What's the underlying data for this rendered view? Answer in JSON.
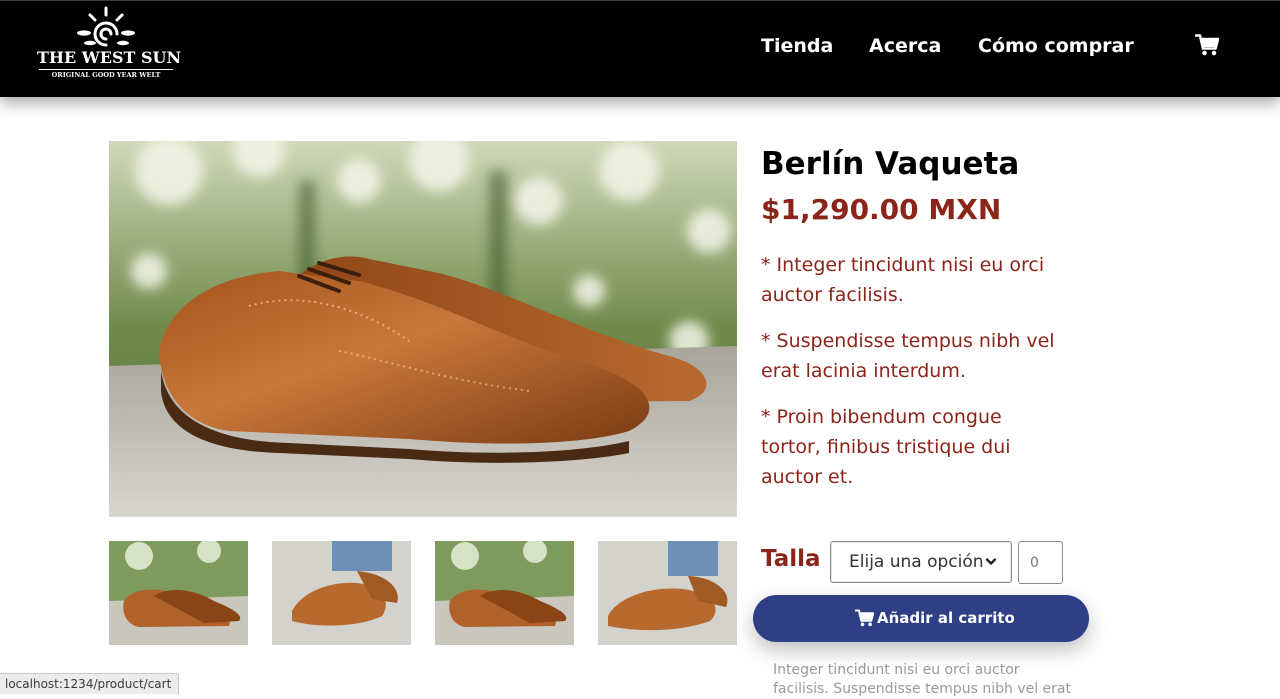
{
  "header": {
    "logo": {
      "title": "THE WEST SUN",
      "subtitle": "ORIGINAL GOOD YEAR WELT"
    },
    "nav": {
      "shop": "Tienda",
      "about": "Acerca",
      "how_to_buy": "Cómo comprar"
    },
    "cart_icon": "shopping-cart-icon"
  },
  "product": {
    "name": "Berlín Vaqueta",
    "price": "$1,290.00 MXN",
    "features": [
      "* Integer tincidunt nisi eu orci auctor facilisis.",
      "* Suspendisse tempus nibh vel erat lacinia interdum.",
      "* Proin bibendum congue tortor, finibus tristique dui auctor et."
    ],
    "size_label": "Talla",
    "size_select": "Elija una opción",
    "quantity_placeholder": "0",
    "add_to_cart": "Añadir al carrito",
    "description": "Integer tincidunt nisi eu orci auctor facilisis. Suspendisse tempus nibh vel erat"
  },
  "status_bar": {
    "url": "localhost:1234/product/cart"
  },
  "colors": {
    "header_bg": "#000000",
    "accent_red": "#8b2419",
    "button_blue": "#2e3f85"
  }
}
